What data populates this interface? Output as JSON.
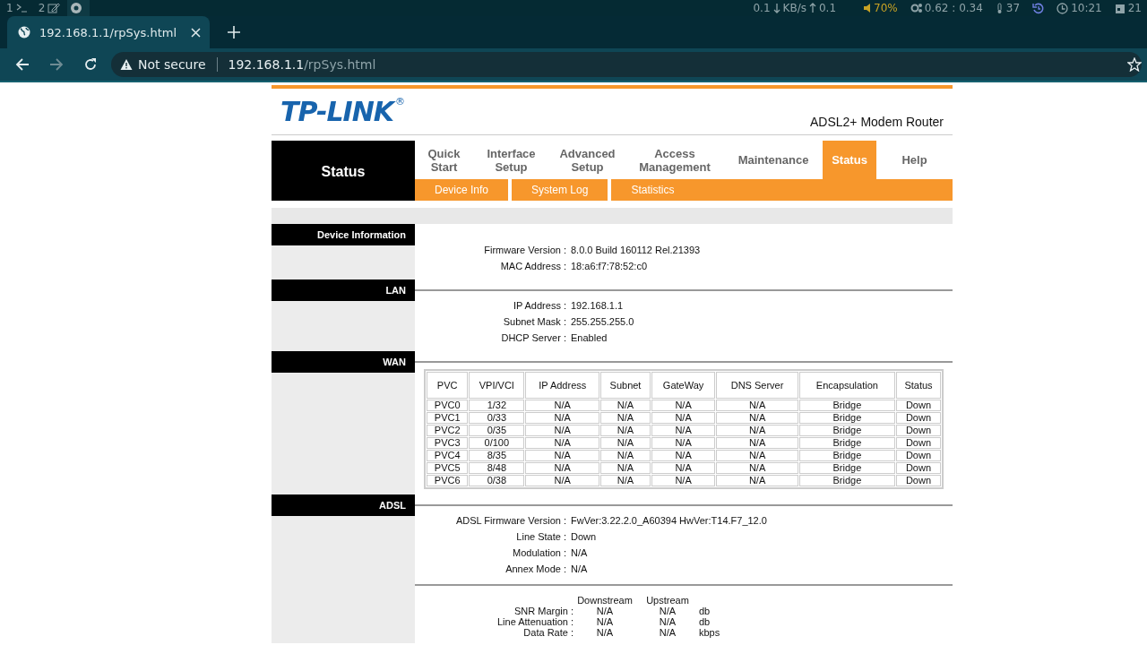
{
  "system_bar": {
    "workspaces": [
      {
        "label": "1",
        "kind": "terminal",
        "selected": false
      },
      {
        "label": "2",
        "kind": "editor",
        "selected": false
      },
      {
        "kind": "browser",
        "selected": true
      }
    ],
    "download": "0.1",
    "rate_unit": "KB/s",
    "upload": "0.1",
    "volume": "70%",
    "load": "0.62 : 0.34",
    "temperature": "37",
    "time": "10:21",
    "date": "21"
  },
  "browser": {
    "tab": {
      "title": "192.168.1.1/rpSys.html"
    },
    "security": "Not secure",
    "url_host": "192.168.1.1",
    "url_path": "/rpSys.html"
  },
  "page": {
    "logo": "TP-LINK",
    "logo_mark": "®",
    "model": "ADSL2+ Modem Router",
    "section_title": "Status",
    "menu": [
      {
        "label": "Quick Start",
        "selected": false
      },
      {
        "label": "Interface Setup",
        "selected": false
      },
      {
        "label": "Advanced Setup",
        "selected": false
      },
      {
        "label": "Access Management",
        "selected": false
      },
      {
        "label": "Maintenance",
        "selected": false
      },
      {
        "label": "Status",
        "selected": true
      },
      {
        "label": "Help",
        "selected": false
      }
    ],
    "submenu": [
      "Device Info",
      "System Log",
      "Statistics"
    ],
    "sections": [
      {
        "title": "Device Information",
        "blocks": [
          {
            "kind": "fields",
            "fields": [
              {
                "label": "Firmware Version :",
                "value": "8.0.0 Build 160112 Rel.21393"
              },
              {
                "label": "MAC Address :",
                "value": "18:a6:f7:78:52:c0"
              }
            ]
          }
        ]
      },
      {
        "title": "LAN",
        "blocks": [
          {
            "kind": "fields",
            "fields": [
              {
                "label": "IP Address :",
                "value": "192.168.1.1"
              },
              {
                "label": "Subnet Mask :",
                "value": "255.255.255.0"
              },
              {
                "label": "DHCP Server :",
                "value": "Enabled"
              }
            ]
          }
        ]
      },
      {
        "title": "WAN",
        "blocks": [
          {
            "kind": "table",
            "columns": [
              "PVC",
              "VPI/VCI",
              "IP Address",
              "Subnet",
              "GateWay",
              "DNS Server",
              "Encapsulation",
              "Status"
            ],
            "rows": [
              [
                "PVC0",
                "1/32",
                "N/A",
                "N/A",
                "N/A",
                "N/A",
                "Bridge",
                "Down"
              ],
              [
                "PVC1",
                "0/33",
                "N/A",
                "N/A",
                "N/A",
                "N/A",
                "Bridge",
                "Down"
              ],
              [
                "PVC2",
                "0/35",
                "N/A",
                "N/A",
                "N/A",
                "N/A",
                "Bridge",
                "Down"
              ],
              [
                "PVC3",
                "0/100",
                "N/A",
                "N/A",
                "N/A",
                "N/A",
                "Bridge",
                "Down"
              ],
              [
                "PVC4",
                "8/35",
                "N/A",
                "N/A",
                "N/A",
                "N/A",
                "Bridge",
                "Down"
              ],
              [
                "PVC5",
                "8/48",
                "N/A",
                "N/A",
                "N/A",
                "N/A",
                "Bridge",
                "Down"
              ],
              [
                "PVC6",
                "0/38",
                "N/A",
                "N/A",
                "N/A",
                "N/A",
                "Bridge",
                "Down"
              ]
            ]
          }
        ]
      },
      {
        "title": "ADSL",
        "blocks": [
          {
            "kind": "fields",
            "fields": [
              {
                "label": "ADSL Firmware Version :",
                "value": "FwVer:3.22.2.0_A60394 HwVer:T14.F7_12.0"
              },
              {
                "label": "Line State :",
                "value": "Down"
              },
              {
                "label": "Modulation :",
                "value": "N/A"
              },
              {
                "label": "Annex Mode :",
                "value": "N/A"
              }
            ]
          },
          {
            "kind": "stats",
            "columns": [
              "Downstream",
              "Upstream"
            ],
            "rows": [
              {
                "label": "SNR Margin :",
                "downstream": "N/A",
                "upstream": "N/A",
                "unit": "db"
              },
              {
                "label": "Line Attenuation :",
                "downstream": "N/A",
                "upstream": "N/A",
                "unit": "db"
              },
              {
                "label": "Data Rate :",
                "downstream": "N/A",
                "upstream": "N/A",
                "unit": "kbps"
              }
            ]
          }
        ]
      }
    ]
  }
}
